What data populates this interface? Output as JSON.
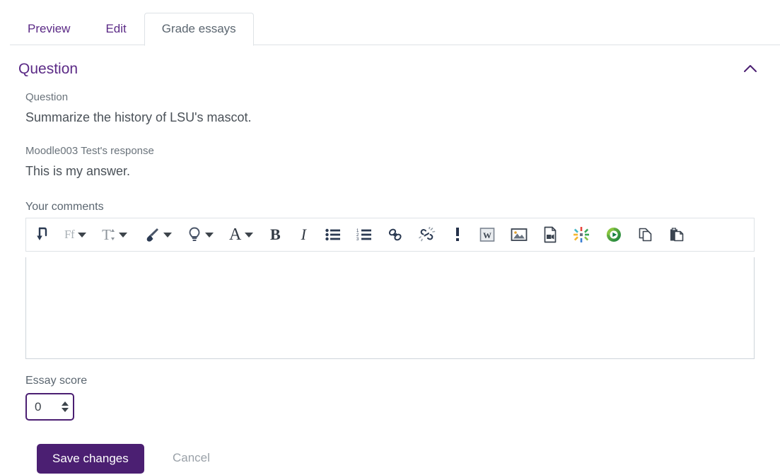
{
  "tabs": [
    {
      "label": "Preview",
      "active": false
    },
    {
      "label": "Edit",
      "active": false
    },
    {
      "label": "Grade essays",
      "active": true
    }
  ],
  "section": {
    "title": "Question",
    "collapse_icon": "chevron-up-icon"
  },
  "question": {
    "label": "Question",
    "text": "Summarize the history of LSU's mascot."
  },
  "response": {
    "label": "Moodle003 Test's response",
    "text": "This is my answer."
  },
  "comments": {
    "label": "Your comments",
    "value": "",
    "placeholder": ""
  },
  "toolbar": {
    "items": [
      {
        "name": "undo-icon",
        "glyph": "arrow-hook-down",
        "caret": false
      },
      {
        "name": "font-family-select",
        "glyph": "Ff",
        "caret": true
      },
      {
        "name": "font-size-select",
        "glyph": "T-size",
        "caret": true
      },
      {
        "name": "text-color-icon",
        "glyph": "paintbrush",
        "caret": true
      },
      {
        "name": "highlight-color-icon",
        "glyph": "lightbulb",
        "caret": true
      },
      {
        "name": "text-style-icon",
        "glyph": "A",
        "caret": true
      },
      {
        "name": "bold-icon",
        "glyph": "B",
        "caret": false
      },
      {
        "name": "italic-icon",
        "glyph": "I",
        "caret": false
      },
      {
        "name": "bullet-list-icon",
        "glyph": "bullet-list",
        "caret": false
      },
      {
        "name": "numbered-list-icon",
        "glyph": "numbered-list",
        "caret": false
      },
      {
        "name": "link-icon",
        "glyph": "chain-link",
        "caret": false
      },
      {
        "name": "unlink-icon",
        "glyph": "broken-chain",
        "caret": false
      },
      {
        "name": "accessibility-alert-icon",
        "glyph": "exclamation",
        "caret": false
      },
      {
        "name": "word-import-icon",
        "glyph": "word-doc",
        "caret": false
      },
      {
        "name": "insert-image-icon",
        "glyph": "picture",
        "caret": false
      },
      {
        "name": "insert-video-icon",
        "glyph": "video-file",
        "caret": false
      },
      {
        "name": "h5p-icon",
        "glyph": "color-pinwheel",
        "caret": false
      },
      {
        "name": "kaltura-media-icon",
        "glyph": "green-play",
        "caret": false
      },
      {
        "name": "copy-icon",
        "glyph": "copy-pages",
        "caret": false
      },
      {
        "name": "paste-icon",
        "glyph": "paste-clipboard",
        "caret": false
      }
    ]
  },
  "score": {
    "label": "Essay score",
    "value": "0",
    "stepper_up": "spinner-up-icon",
    "stepper_down": "spinner-down-icon"
  },
  "footer": {
    "save_label": "Save changes",
    "cancel_label": "Cancel"
  },
  "colors": {
    "accent_purple": "#4b1f72",
    "link_purple": "#5b2a86",
    "body_text": "#3d444b",
    "muted_text": "#6a737b",
    "border": "#dee2e6"
  }
}
